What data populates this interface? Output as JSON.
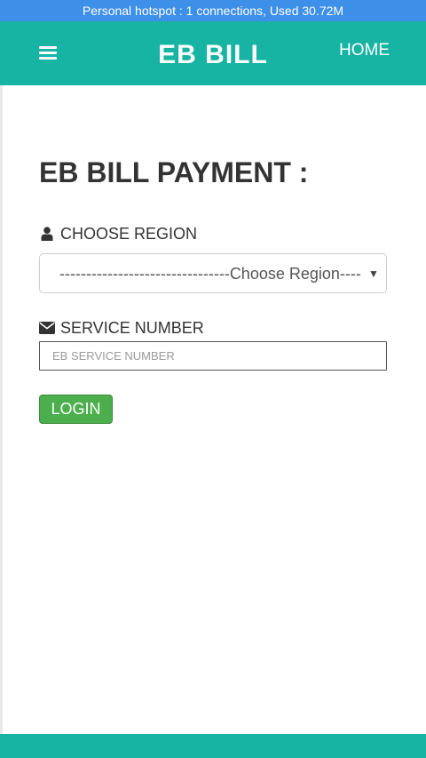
{
  "status_bar": {
    "text": "Personal hotspot : 1 connections, Used 30.72M"
  },
  "nav": {
    "menu_icon": "hamburger-menu-icon",
    "brand": "EB BILL",
    "home_label": "HOME"
  },
  "main": {
    "title": "EB BILL PAYMENT :",
    "region": {
      "label": "CHOOSE REGION",
      "icon": "user-icon",
      "selected": "--------------------------------Choose Region---------"
    },
    "service": {
      "label": "SERVICE NUMBER",
      "icon": "envelope-icon",
      "placeholder": "EB SERVICE NUMBER",
      "value": ""
    },
    "login_label": "LOGIN"
  },
  "colors": {
    "status_bar": "#3d8fe8",
    "nav_bar": "#17b3a3",
    "login_button": "#4cae4c",
    "footer": "#17b3a3"
  }
}
